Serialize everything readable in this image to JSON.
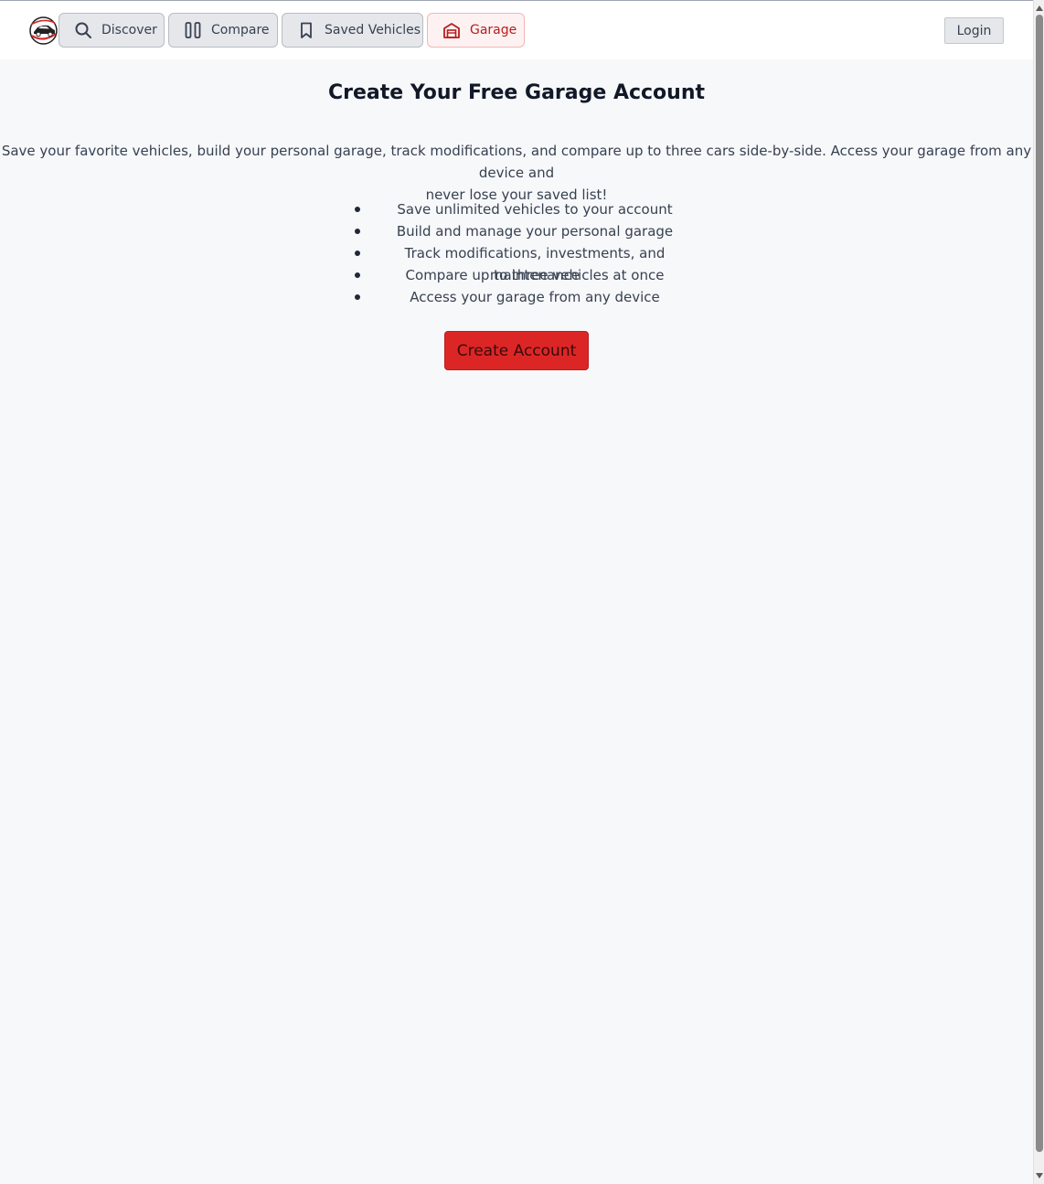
{
  "header": {
    "logo_icon": "car-logo-icon",
    "nav": [
      {
        "label": "Discover",
        "icon": "search-icon",
        "active": false
      },
      {
        "label": "Compare",
        "icon": "columns-icon",
        "active": false
      },
      {
        "label": "Saved Vehicles",
        "icon": "bookmark-icon",
        "active": false
      },
      {
        "label": "Garage",
        "icon": "garage-icon",
        "active": true
      }
    ],
    "login_label": "Login"
  },
  "main": {
    "title": "Create Your Free Garage Account",
    "intro_line1": "Save your favorite vehicles, build your personal garage, track modifications, and compare up to three cars side-by-side. Access your garage from any device and",
    "intro_line2": "never lose your saved list!",
    "features": [
      "Save unlimited vehicles to your account",
      "Build and manage your personal garage",
      "Track modifications, investments, and maintenance",
      "Compare up to three vehicles at once",
      "Access your garage from any device"
    ],
    "cta_label": "Create Account"
  },
  "colors": {
    "accent": "#dc2626",
    "active_tab_bg": "#fdf1f1",
    "active_tab_text": "#b91c1c",
    "page_bg": "#f7f8fa"
  }
}
